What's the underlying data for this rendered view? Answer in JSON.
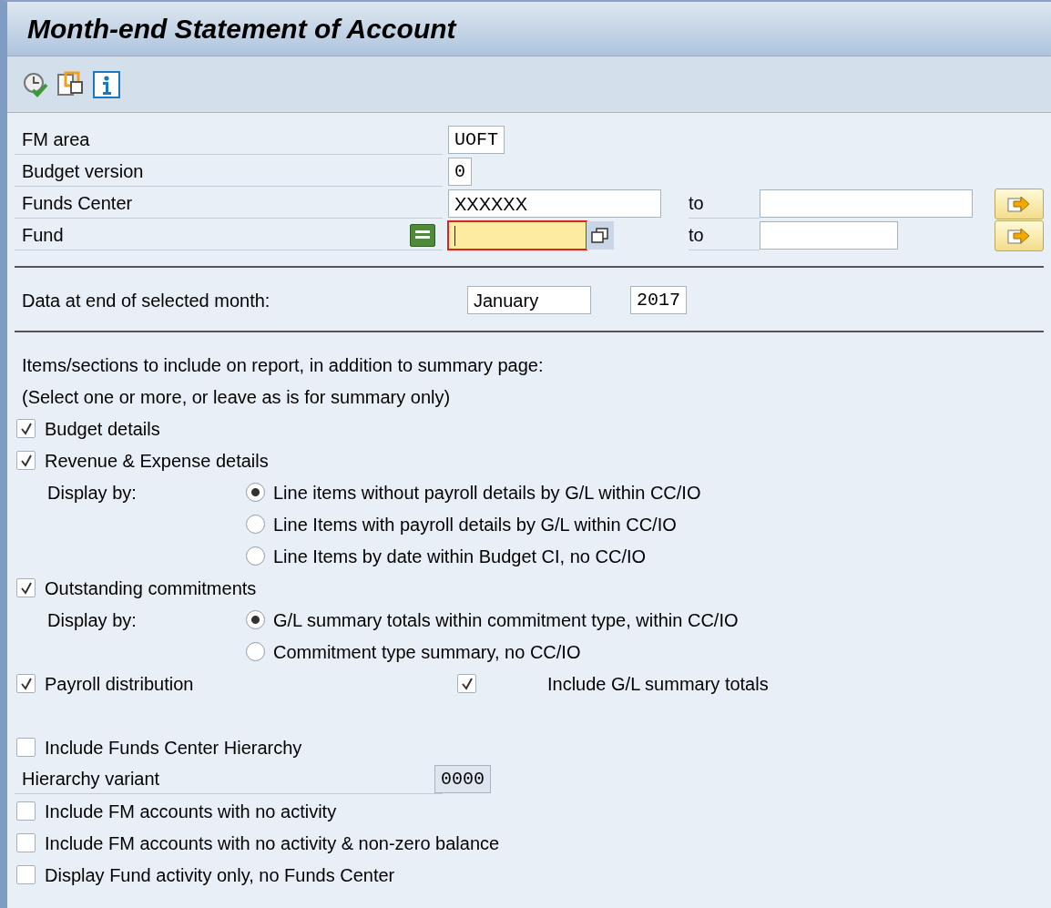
{
  "window": {
    "title": "Month-end Statement of Account"
  },
  "selection": [
    {
      "label": "FM area",
      "value": "UOFT",
      "kind": "single",
      "focused": false
    },
    {
      "label": "Budget version",
      "value": "0",
      "kind": "single",
      "focused": false
    },
    {
      "label": "Funds Center",
      "value": "XXXXXX",
      "kind": "range",
      "to_label": "to",
      "focused": false,
      "has_option": false
    },
    {
      "label": "Fund",
      "kind": "range",
      "to_label": "to",
      "focused": true,
      "has_option": true
    }
  ],
  "period": {
    "label": "Data at end of selected month:",
    "month": "January",
    "year": "2017"
  },
  "intro": [
    "Items/sections to include on report, in addition to summary page:",
    "(Select one or more, or leave as is for summary only)"
  ],
  "sections": [
    {
      "label": "Budget details",
      "checked": true
    },
    {
      "label": "Revenue & Expense details",
      "checked": true,
      "display_label": "Display by:",
      "radios": [
        {
          "label": "Line items without payroll details by G/L within CC/IO",
          "selected": true
        },
        {
          "label": "Line Items with payroll details by G/L within CC/IO",
          "selected": false
        },
        {
          "label": "Line Items by date within Budget CI, no CC/IO",
          "selected": false
        }
      ]
    },
    {
      "label": "Outstanding commitments",
      "checked": true,
      "display_label": "Display by:",
      "radios": [
        {
          "label": "G/L summary totals within commitment type, within CC/IO",
          "selected": true
        },
        {
          "label": "Commitment type summary, no CC/IO",
          "selected": false
        }
      ]
    },
    {
      "label": "Payroll distribution",
      "checked": true,
      "extra": {
        "label": "Include G/L summary totals",
        "checked": true
      }
    }
  ],
  "other_options": [
    {
      "kind": "checkbox",
      "label": "Include Funds Center Hierarchy",
      "checked": false
    },
    {
      "kind": "field",
      "label": "Hierarchy variant",
      "value": "0000"
    },
    {
      "kind": "checkbox",
      "label": "Include FM accounts with no activity",
      "checked": false
    },
    {
      "kind": "checkbox",
      "label": "Include FM accounts with no activity & non-zero balance",
      "checked": false
    },
    {
      "kind": "checkbox",
      "label": "Display Fund activity only, no Funds Center",
      "checked": false
    }
  ]
}
